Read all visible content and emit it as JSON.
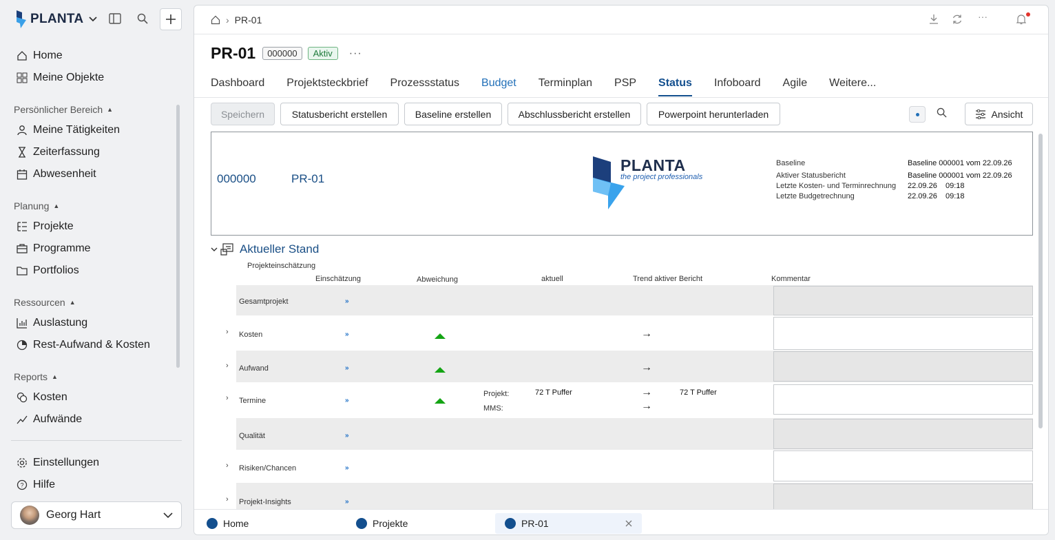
{
  "sidebar": {
    "brand": "PLANTA",
    "home": "Home",
    "my_objects": "Meine Objekte",
    "sec_personal": "Persönlicher Bereich",
    "my_tasks": "Meine Tätigkeiten",
    "time": "Zeiterfassung",
    "absence": "Abwesenheit",
    "sec_planning": "Planung",
    "projects": "Projekte",
    "programs": "Programme",
    "portfolios": "Portfolios",
    "sec_resources": "Ressourcen",
    "utilization": "Auslastung",
    "rest": "Rest-Aufwand & Kosten",
    "sec_reports": "Reports",
    "costs": "Kosten",
    "efforts": "Aufwände",
    "settings": "Einstellungen",
    "help": "Hilfe",
    "user": "Georg Hart"
  },
  "breadcrumb": {
    "current": "PR-01"
  },
  "page": {
    "title": "PR-01",
    "number": "000000",
    "status": "Aktiv",
    "more": "···"
  },
  "tabs": [
    "Dashboard",
    "Projektsteckbrief",
    "Prozessstatus",
    "Budget",
    "Terminplan",
    "PSP",
    "Status",
    "Infoboard",
    "Agile",
    "Weitere..."
  ],
  "toolbar": {
    "save": "Speichern",
    "status_report": "Statusbericht erstellen",
    "baseline": "Baseline erstellen",
    "final_report": "Abschlussbericht erstellen",
    "powerpoint": "Powerpoint herunterladen",
    "view": "Ansicht"
  },
  "header": {
    "number": "000000",
    "project": "PR-01",
    "logo_name": "PLANTA",
    "logo_sub": "the project professionals",
    "meta": [
      {
        "label": "Baseline",
        "value": "Baseline 000001 vom 22.09.26"
      },
      {
        "label": "Aktiver Statusbericht",
        "value": "Baseline 000001 vom 22.09.26"
      },
      {
        "label": "Letzte Kosten- und Terminrechnung",
        "date": "22.09.26",
        "time": "09:18"
      },
      {
        "label": "Letzte Budgetrechnung",
        "date": "22.09.26",
        "time": "09:18"
      }
    ]
  },
  "section": {
    "title": "Aktueller Stand",
    "subtitle": "Projekteinschätzung",
    "columns": {
      "assessment": "Einschätzung",
      "deviation": "Abweichung",
      "current": "aktuell",
      "trend": "Trend aktiver Bericht",
      "comment": "Kommentar"
    },
    "rows": [
      {
        "label": "Gesamtprojekt",
        "marker": "»"
      },
      {
        "label": "Kosten",
        "marker": "»",
        "arrow": "→"
      },
      {
        "label": "Aufwand",
        "marker": "»",
        "arrow": "→"
      },
      {
        "label": "Termine",
        "marker": "»",
        "arrow": "→",
        "arrow2": "→",
        "proj_label": "Projekt:",
        "proj_value": "72 T Puffer",
        "trend_value": "72 T Puffer",
        "mms_label": "MMS:"
      },
      {
        "label": "Qualität",
        "marker": "»"
      },
      {
        "label": "Risiken/Chancen",
        "marker": "»"
      },
      {
        "label": "Projekt-Insights",
        "marker": "»"
      }
    ]
  },
  "bottom_tabs": [
    "Home",
    "Projekte",
    "PR-01"
  ],
  "colors": {
    "accent": "#134f8e",
    "link": "#2270b8",
    "ok": "#14a414"
  }
}
